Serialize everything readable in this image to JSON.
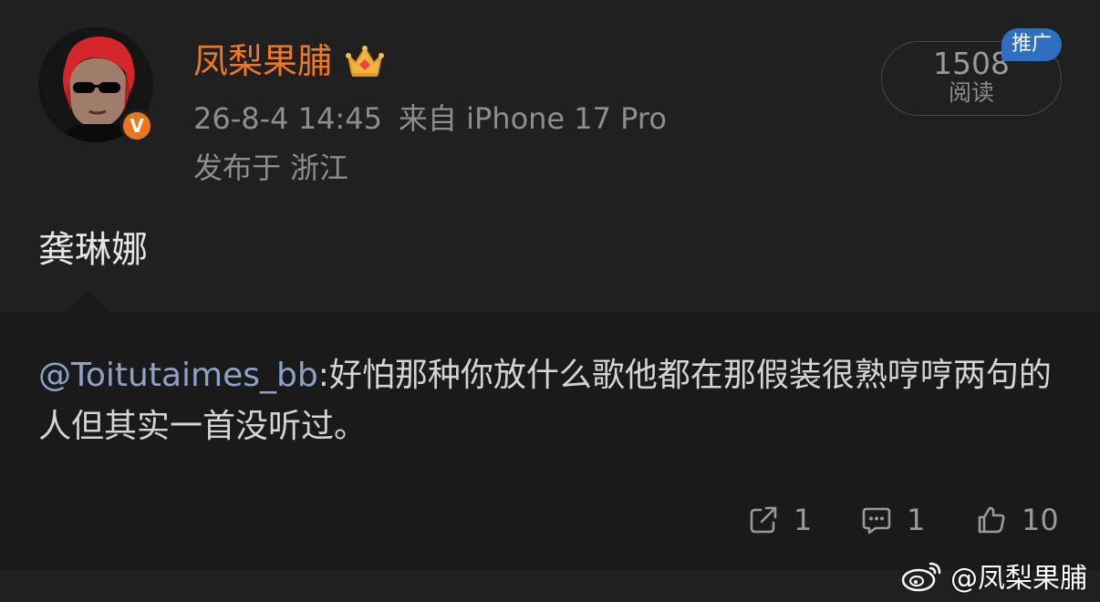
{
  "post": {
    "username": "凤梨果脯",
    "timestamp": "26-8-4 14:45",
    "source": "来自 iPhone 17 Pro",
    "location_prefix": "发布于",
    "location": "浙江",
    "read_count": "1508",
    "read_label": "阅读",
    "promo_tag": "推广",
    "content": "龚琳娜"
  },
  "repost": {
    "mention": "@Toitutaimes_bb",
    "text": ":好怕那种你放什么歌他都在那假装很熟哼哼两句的人但其实一首没听过。"
  },
  "actions": {
    "share_count": "1",
    "comment_count": "1",
    "like_count": "10"
  },
  "watermark": {
    "text": "@凤梨果脯"
  },
  "colors": {
    "background": "#202020",
    "repost_background": "#1a1a1a",
    "username": "#f0781e",
    "mention": "#8aa2cc",
    "promo": "#2e6fc1",
    "verified_badge": "#f0751a"
  }
}
